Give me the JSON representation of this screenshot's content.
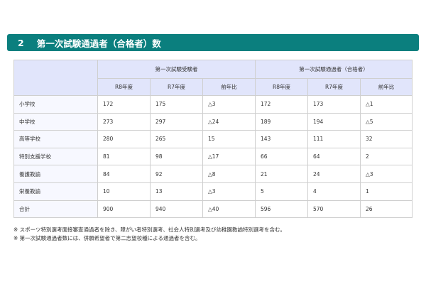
{
  "header": {
    "number": "2",
    "title": "第一次試験通過者（合格者）数"
  },
  "table": {
    "group_headers": [
      "第一次試験受験者",
      "第一次試験通過者（合格者）"
    ],
    "sub_headers": [
      "R8年度",
      "R7年度",
      "前年比",
      "R8年度",
      "R7年度",
      "前年比"
    ],
    "rows": [
      {
        "label": "小学校",
        "cells": [
          "172",
          "175",
          "△3",
          "172",
          "173",
          "△1"
        ]
      },
      {
        "label": "中学校",
        "cells": [
          "273",
          "297",
          "△24",
          "189",
          "194",
          "△5"
        ]
      },
      {
        "label": "高等学校",
        "cells": [
          "280",
          "265",
          "15",
          "143",
          "111",
          "32"
        ]
      },
      {
        "label": "特別支援学校",
        "cells": [
          "81",
          "98",
          "△17",
          "66",
          "64",
          "2"
        ]
      },
      {
        "label": "養護教諭",
        "cells": [
          "84",
          "92",
          "△8",
          "21",
          "24",
          "△3"
        ]
      },
      {
        "label": "栄養教諭",
        "cells": [
          "10",
          "13",
          "△3",
          "5",
          "4",
          "1"
        ]
      },
      {
        "label": "合計",
        "cells": [
          "900",
          "940",
          "△40",
          "596",
          "570",
          "26"
        ]
      }
    ]
  },
  "notes": [
    "※ スポーツ特別選考面接審査通過者を除き、障がい者特別選考、社会人特別選考及び幼稚園教諭特別選考を含む。",
    "※ 第一次試験通過者数には、併願希望者で第二志望校種による通過者を含む。"
  ]
}
